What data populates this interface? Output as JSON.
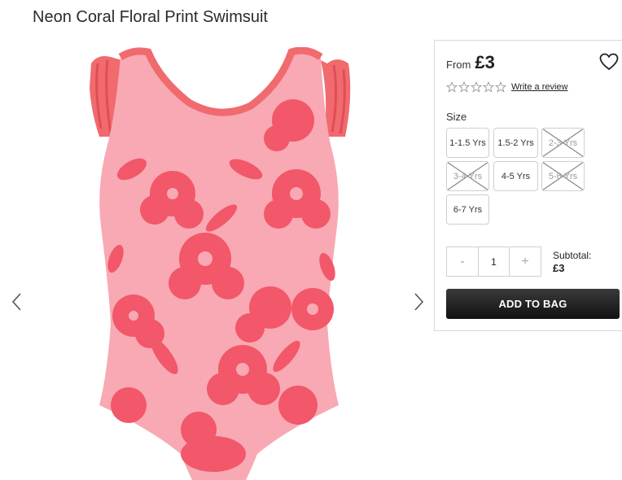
{
  "product": {
    "title": "Neon Coral Floral Print Swimsuit",
    "image_icon": "swimsuit-product-image"
  },
  "gallery": {
    "prev_icon": "chevron-left-icon",
    "next_icon": "chevron-right-icon"
  },
  "panel": {
    "price_prefix": "From",
    "price": "£3",
    "wishlist_icon": "heart-outline-icon",
    "rating": {
      "stars_filled": 0,
      "stars_total": 5,
      "review_link": "Write a review"
    },
    "size_label": "Size",
    "sizes": [
      {
        "label": "1-1.5 Yrs",
        "available": true
      },
      {
        "label": "1.5-2 Yrs",
        "available": true
      },
      {
        "label": "2-3 Yrs",
        "available": false
      },
      {
        "label": "3-4 Yrs",
        "available": false
      },
      {
        "label": "4-5 Yrs",
        "available": true
      },
      {
        "label": "5-6 Yrs",
        "available": false
      },
      {
        "label": "6-7 Yrs",
        "available": true
      }
    ],
    "quantity": {
      "minus": "-",
      "value": "1",
      "plus": "+"
    },
    "subtotal_label": "Subtotal:",
    "subtotal_value": "£3",
    "add_to_bag": "ADD TO BAG"
  },
  "colors": {
    "coral": "#f2576a",
    "pink": "#f8a9b3",
    "button_dark": "#1e1e1e"
  }
}
